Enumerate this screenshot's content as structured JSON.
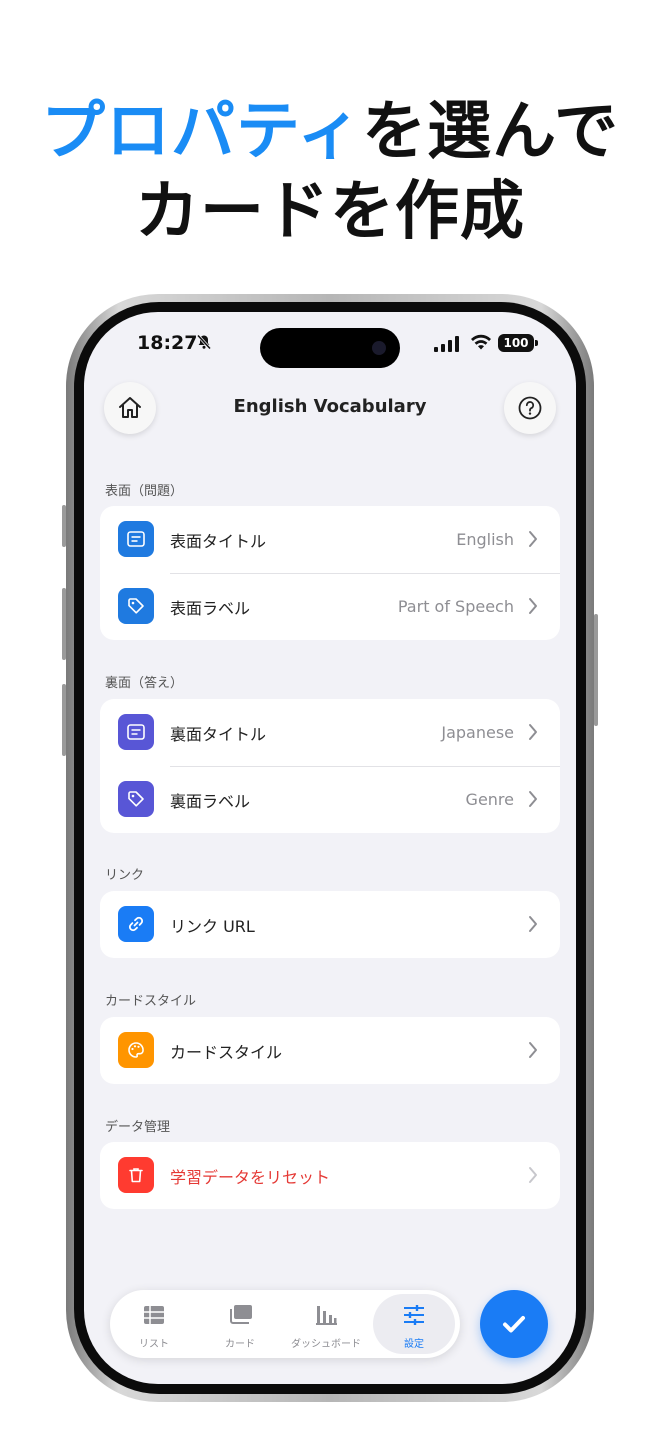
{
  "headline": {
    "line1_accent": "プロパティ",
    "line1_rest": "を選んで",
    "line2": "カードを作成"
  },
  "status": {
    "time": "18:27",
    "battery": "100"
  },
  "nav": {
    "title": "English Vocabulary"
  },
  "sections": {
    "front": {
      "label": "表面（問題）",
      "items": [
        {
          "label": "表面タイトル",
          "value": "English"
        },
        {
          "label": "表面ラベル",
          "value": "Part of Speech"
        }
      ]
    },
    "back": {
      "label": "裏面（答え）",
      "items": [
        {
          "label": "裏面タイトル",
          "value": "Japanese"
        },
        {
          "label": "裏面ラベル",
          "value": "Genre"
        }
      ]
    },
    "link": {
      "label": "リンク",
      "items": [
        {
          "label": "リンク URL"
        }
      ]
    },
    "style": {
      "label": "カードスタイル",
      "items": [
        {
          "label": "カードスタイル"
        }
      ]
    },
    "data": {
      "label": "データ管理",
      "items": [
        {
          "label": "学習データをリセット"
        }
      ]
    }
  },
  "tabs": [
    {
      "label": "リスト"
    },
    {
      "label": "カード"
    },
    {
      "label": "ダッシュボード"
    },
    {
      "label": "設定"
    }
  ],
  "colors": {
    "accent": "#1a7cf5",
    "front_icon": "#1f7ae0",
    "back_icon": "#5856d6",
    "link_icon": "#1a7cf5",
    "style_icon": "#ff9500",
    "danger": "#ff3b30"
  }
}
